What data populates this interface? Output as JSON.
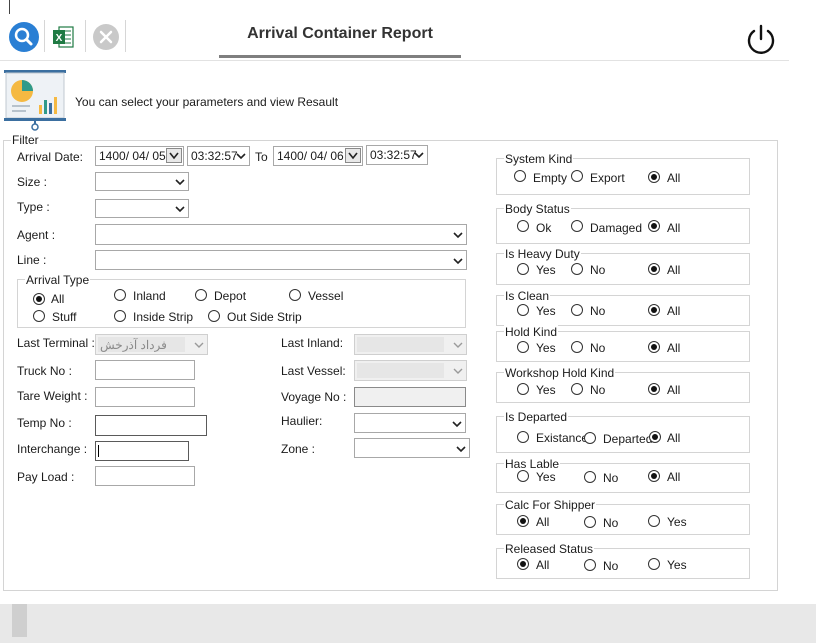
{
  "toolbar": {
    "title": "Arrival Container Report",
    "search_icon": "search-icon",
    "excel_icon": "excel-icon",
    "close_icon": "close-icon",
    "power_icon": "power-icon"
  },
  "banner": {
    "text": "You can select your parameters  and view Resault",
    "icon": "presentation-chart-icon"
  },
  "filter": {
    "legend": "Filter",
    "arrival_date_label": "Arrival Date:",
    "date_from": "1400/ 04/ 05",
    "time_from": "03:32:57",
    "to_label": "To",
    "date_to": "1400/ 04/ 06",
    "time_to": "03:32:57",
    "size_label": "Size :",
    "type_label": "Type :",
    "agent_label": "Agent :",
    "line_label": "Line :",
    "arrival_type": {
      "title": "Arrival Type",
      "options": [
        "All",
        "Inland",
        "Depot",
        "Vessel",
        "Stuff",
        "Inside Strip",
        "Out Side Strip"
      ],
      "selected": "All"
    },
    "last_terminal_label": "Last Terminal :",
    "last_terminal_value": "فرداد آذرخش",
    "last_inland_label": "Last Inland:",
    "truck_no_label": "Truck No :",
    "last_vessel_label": "Last Vessel:",
    "tare_weight_label": "Tare Weight :",
    "voyage_no_label": "Voyage No :",
    "temp_no_label": "Temp No :",
    "haulier_label": "Haulier:",
    "interchange_label": "Interchange :",
    "zone_label": "Zone :",
    "pay_load_label": "Pay Load :"
  },
  "groups": [
    {
      "title": "System Kind",
      "options": [
        "Empty",
        "Export",
        "All"
      ],
      "selected": "All"
    },
    {
      "title": "Body Status",
      "options": [
        "Ok",
        "Damaged",
        "All"
      ],
      "selected": "All"
    },
    {
      "title": "Is Heavy Duty",
      "options": [
        "Yes",
        "No",
        "All"
      ],
      "selected": "All"
    },
    {
      "title": "Is Clean",
      "options": [
        "Yes",
        "No",
        "All"
      ],
      "selected": "All"
    },
    {
      "title": "Hold Kind",
      "options": [
        "Yes",
        "No",
        "All"
      ],
      "selected": "All"
    },
    {
      "title": "Workshop Hold  Kind",
      "options": [
        "Yes",
        "No",
        "All"
      ],
      "selected": "All"
    },
    {
      "title": "Is Departed",
      "options": [
        "Existance",
        "Departed",
        "All"
      ],
      "selected": "All"
    },
    {
      "title": "Has Lable",
      "options": [
        "Yes",
        "No",
        "All"
      ],
      "selected": "All"
    },
    {
      "title": "Calc For Shipper",
      "options": [
        "All",
        "No",
        "Yes"
      ],
      "selected": "All"
    },
    {
      "title": "Released Status",
      "options": [
        "All",
        "No",
        "Yes"
      ],
      "selected": "All"
    }
  ]
}
